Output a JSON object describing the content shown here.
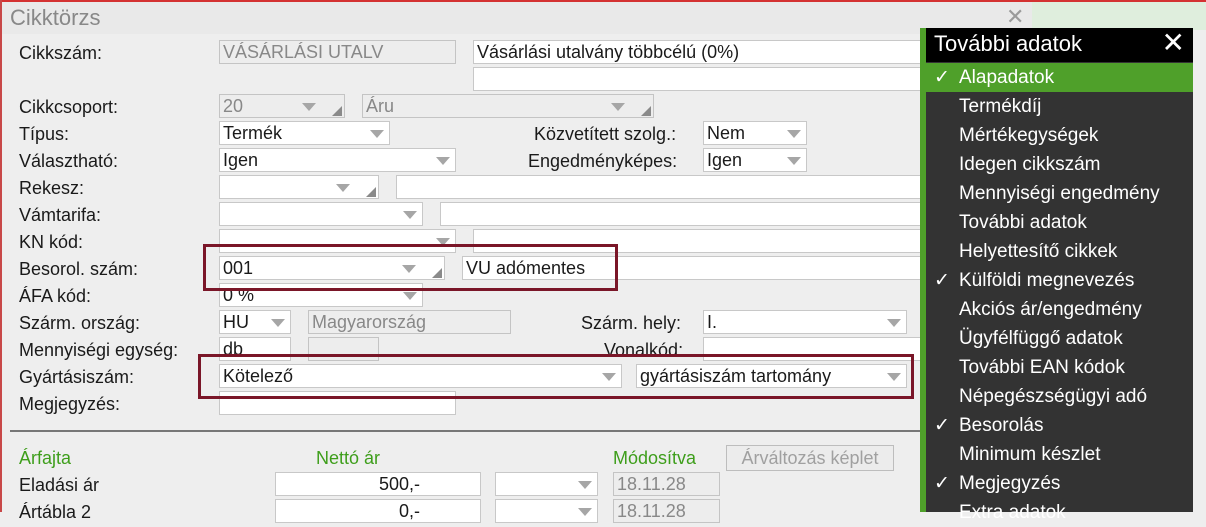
{
  "window": {
    "title": "Cikktörzs",
    "close_glyph": "✕"
  },
  "form": {
    "cikkszam": {
      "label": "Cikkszám:",
      "code": "VÁSÁRLÁSI UTALV",
      "name": "Vásárlási utalvány többcélú (0%)",
      "name2": ""
    },
    "cikkcsoport": {
      "label": "Cikkcsoport:",
      "code": "20",
      "name": "Áru"
    },
    "tipus": {
      "label": "Típus:",
      "value": "Termék"
    },
    "kozvetitett": {
      "label": "Közvetített szolg.:",
      "value": "Nem"
    },
    "valaszthato": {
      "label": "Választható:",
      "value": "Igen"
    },
    "engedmenykepes": {
      "label": "Engedményképes:",
      "value": "Igen"
    },
    "rekesz": {
      "label": "Rekesz:",
      "value": "",
      "text": ""
    },
    "vamtarifa": {
      "label": "Vámtarifa:",
      "value": "",
      "text": ""
    },
    "kn": {
      "label": "KN kód:",
      "value": "",
      "text": ""
    },
    "besorol": {
      "label": "Besorol. szám:",
      "code": "001",
      "name": "VU adómentes"
    },
    "afa": {
      "label": "ÁFA kód:",
      "value": "0 %"
    },
    "szarm_orszag": {
      "label": "Szárm. ország:",
      "code": "HU",
      "name": "Magyarország"
    },
    "szarm_hely": {
      "label": "Szárm. hely:",
      "value": "I."
    },
    "menny_egyseg": {
      "label": "Mennyiségi egység:",
      "value": "db",
      "value2": ""
    },
    "vonalkod": {
      "label": "Vonalkód:",
      "value": ""
    },
    "gyartasiszam": {
      "label": "Gyártásiszám:",
      "value": "Kötelező",
      "range": "gyártásiszám tartomány"
    },
    "megjegyzes": {
      "label": "Megjegyzés:",
      "value": ""
    }
  },
  "prices": {
    "headers": {
      "type": "Árfajta",
      "net": "Nettó ár",
      "modified": "Módosítva",
      "formula_button": "Árváltozás képlet"
    },
    "rows": [
      {
        "name": "Eladási ár",
        "net": "500,-",
        "currency": "",
        "date": "18.11.28"
      },
      {
        "name": "Ártábla 2",
        "net": "0,-",
        "currency": "",
        "date": "18.11.28"
      }
    ]
  },
  "panel": {
    "title": "További adatok",
    "close_glyph": "✕",
    "check_glyph": "✓",
    "items": [
      {
        "label": "Alapadatok",
        "checked": true,
        "active": true
      },
      {
        "label": "Termékdíj",
        "checked": false,
        "active": false
      },
      {
        "label": "Mértékegységek",
        "checked": false,
        "active": false
      },
      {
        "label": "Idegen cikkszám",
        "checked": false,
        "active": false
      },
      {
        "label": "Mennyiségi engedmény",
        "checked": false,
        "active": false
      },
      {
        "label": "További adatok",
        "checked": false,
        "active": false
      },
      {
        "label": "Helyettesítő cikkek",
        "checked": false,
        "active": false
      },
      {
        "label": "Külföldi megnevezés",
        "checked": true,
        "active": false
      },
      {
        "label": "Akciós ár/engedmény",
        "checked": false,
        "active": false
      },
      {
        "label": "Ügyfélfüggő adatok",
        "checked": false,
        "active": false
      },
      {
        "label": "További EAN kódok",
        "checked": false,
        "active": false
      },
      {
        "label": "Népegészségügyi adó",
        "checked": false,
        "active": false
      },
      {
        "label": "Besorolás",
        "checked": true,
        "active": false
      },
      {
        "label": "Minimum készlet",
        "checked": false,
        "active": false
      },
      {
        "label": "Megjegyzés",
        "checked": true,
        "active": false
      },
      {
        "label": "Extra adatok",
        "checked": false,
        "active": false
      }
    ]
  },
  "colors": {
    "accent_green": "#4fa02a",
    "highlight_border": "#7a1628",
    "panel_bg": "#333333"
  }
}
